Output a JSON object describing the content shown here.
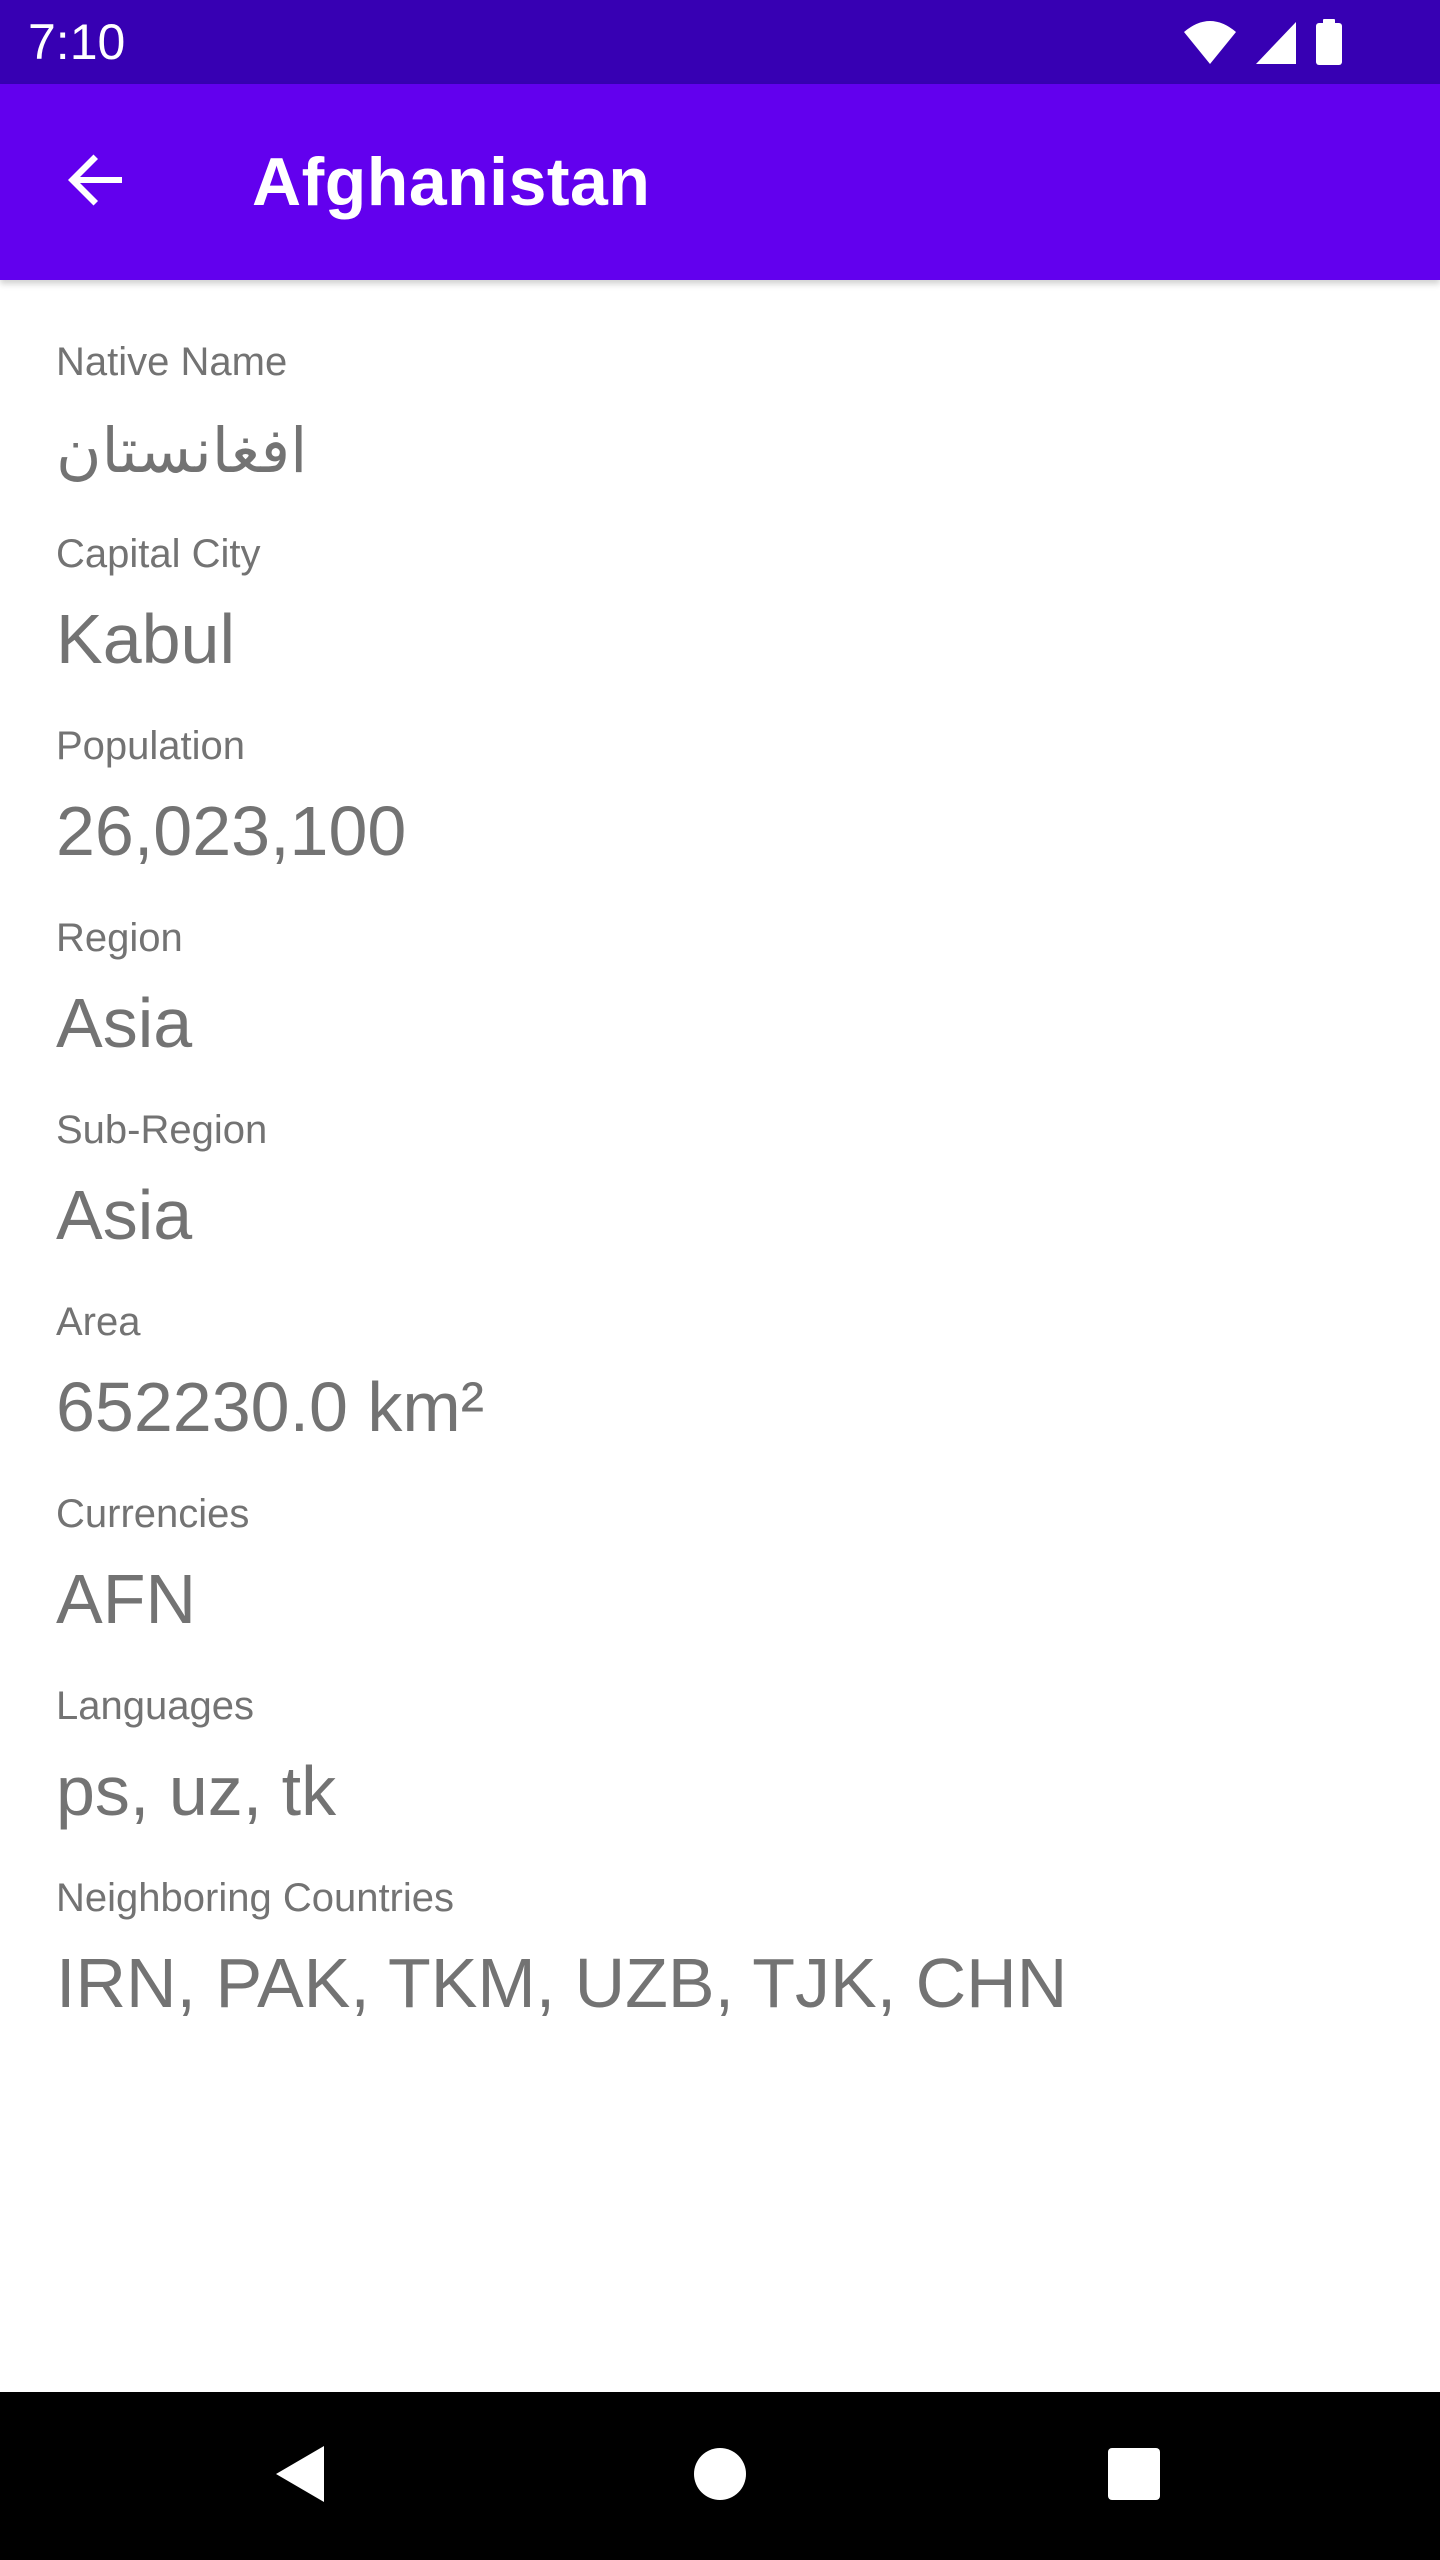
{
  "status_bar": {
    "time": "7:10",
    "icons": [
      "wifi-icon",
      "signal-icon",
      "battery-icon"
    ],
    "background": "#3700b3"
  },
  "app_bar": {
    "title": "Afghanistan",
    "back_icon": "arrow-back-icon",
    "background": "#6200ee"
  },
  "details": {
    "native_name": {
      "label": "Native Name",
      "value": "افغانستان"
    },
    "capital": {
      "label": "Capital City",
      "value": "Kabul"
    },
    "population": {
      "label": "Population",
      "value": "26,023,100"
    },
    "region": {
      "label": "Region",
      "value": "Asia"
    },
    "sub_region": {
      "label": "Sub-Region",
      "value": "Asia"
    },
    "area": {
      "label": "Area",
      "value": "652230.0 km²"
    },
    "currencies": {
      "label": "Currencies",
      "value": "AFN"
    },
    "languages": {
      "label": "Languages",
      "value": "ps, uz, tk"
    },
    "neighbors": {
      "label": "Neighboring Countries",
      "value": "IRN, PAK, TKM, UZB, TJK, CHN"
    }
  },
  "nav_bar": {
    "buttons": [
      "back-triangle-icon",
      "home-circle-icon",
      "recents-square-icon"
    ]
  }
}
